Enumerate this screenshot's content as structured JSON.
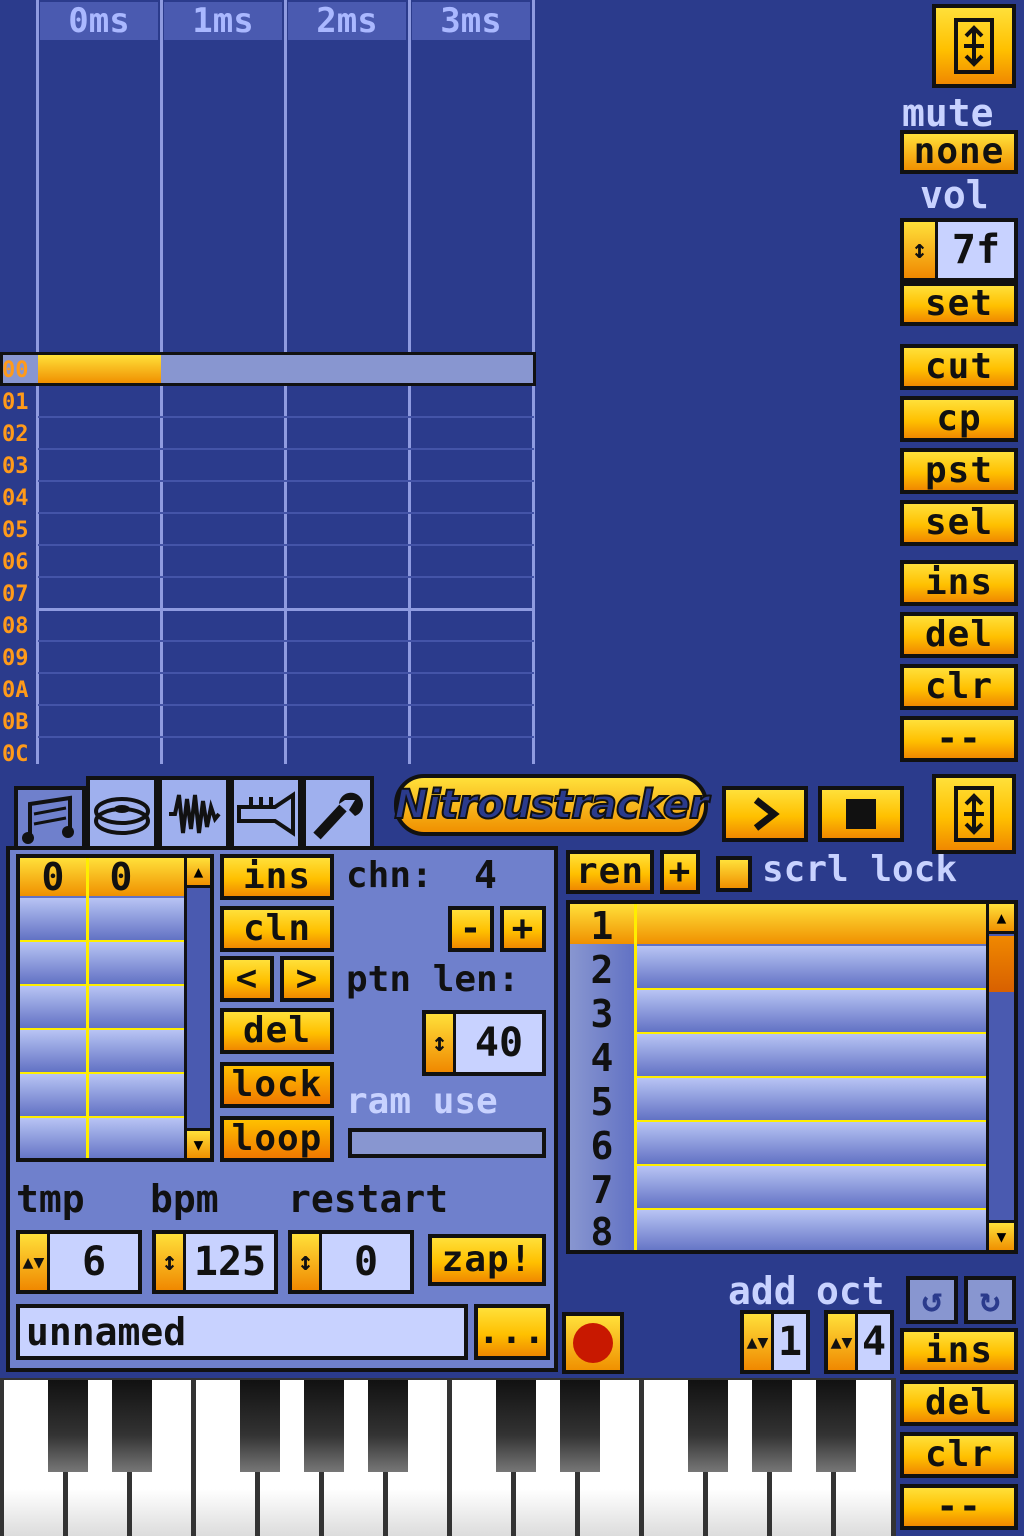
{
  "header": {
    "columns": [
      "0ms",
      "1ms",
      "2ms",
      "3ms"
    ]
  },
  "pattern": {
    "rows": [
      "00",
      "01",
      "02",
      "03",
      "04",
      "05",
      "06",
      "07",
      "08",
      "09",
      "0A",
      "0B",
      "0C"
    ]
  },
  "right_panel": {
    "mute_label": "mute",
    "mute_value": "none",
    "vol_label": "vol",
    "vol_value": "7f",
    "set": "set",
    "cut": "cut",
    "cp": "cp",
    "pst": "pst",
    "sel": "sel",
    "ins": "ins",
    "del": "del",
    "clr": "clr",
    "dash": "--"
  },
  "logo": "Nitroustracker",
  "instrument_panel": {
    "list_header": [
      "0",
      "0"
    ],
    "ins": "ins",
    "cln": "cln",
    "prev": "<",
    "next": ">",
    "del": "del",
    "lock": "lock",
    "loop": "loop",
    "chn_label": "chn:",
    "chn_value": "4",
    "minus": "-",
    "plus": "+",
    "ptn_len_label": "ptn len:",
    "ptn_len_value": "40",
    "ram_use_label": "ram use",
    "tmp_label": "tmp",
    "bpm_label": "bpm",
    "restart_label": "restart",
    "tmp_value": "6",
    "bpm_value": "125",
    "restart_value": "0",
    "zap": "zap!",
    "song_name": "unnamed",
    "more": "..."
  },
  "order_panel": {
    "ren": "ren",
    "plus": "+",
    "scrl_lock": "scrl lock",
    "rows": [
      "1",
      "2",
      "3",
      "4",
      "5",
      "6",
      "7",
      "8"
    ]
  },
  "bottom_right": {
    "add_label": "add",
    "oct_label": "oct",
    "add_value": "1",
    "oct_value": "4",
    "ins": "ins",
    "del": "del",
    "clr": "clr",
    "dash": "--"
  },
  "colors": {
    "background": "#2b3b8c",
    "accent": "#ffc000",
    "label": "#c8d2ff",
    "row_number": "#ff9a1a",
    "highlight_line": "#ffee00"
  }
}
